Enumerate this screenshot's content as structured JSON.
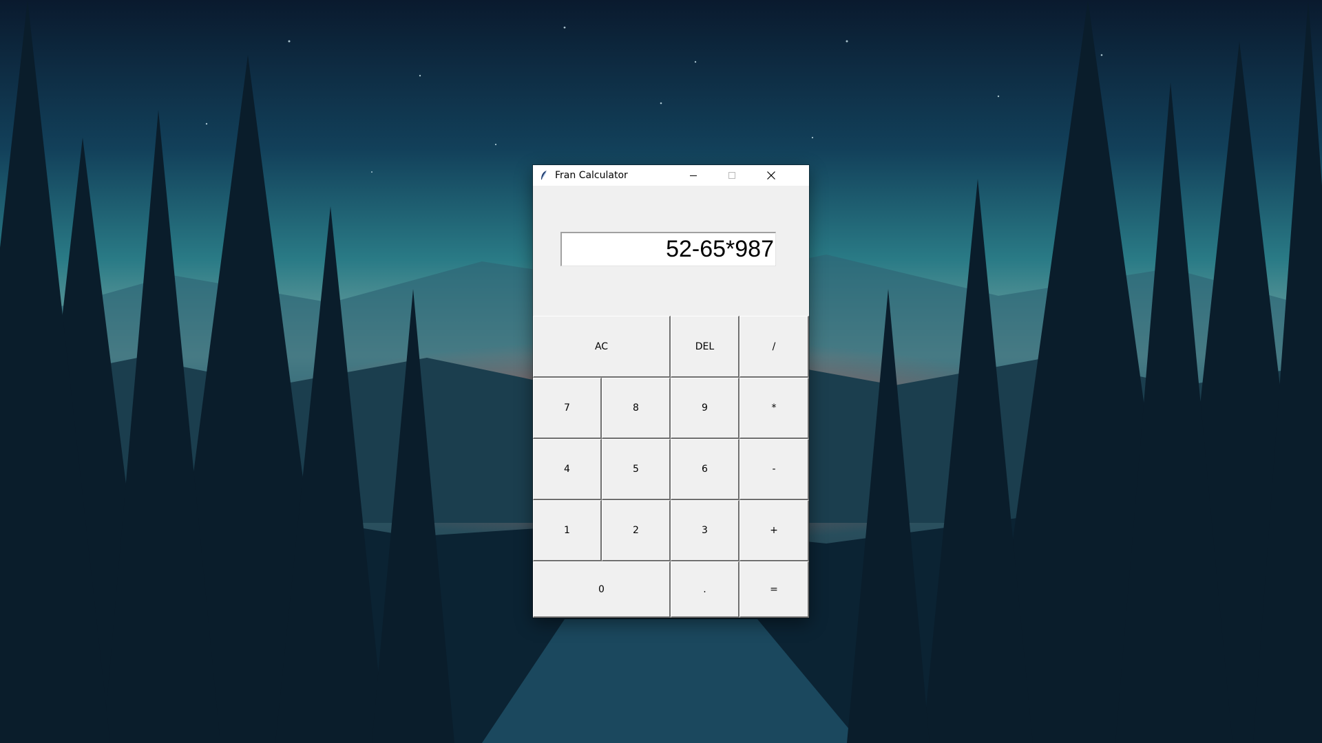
{
  "window": {
    "title": "Fran Calculator",
    "app_icon": "feather-icon",
    "controls": [
      "minimize",
      "maximize",
      "close"
    ]
  },
  "display": {
    "value": "52-65*987"
  },
  "keypad": {
    "rows": [
      [
        "AC",
        "DEL",
        "/"
      ],
      [
        "7",
        "8",
        "9",
        "*"
      ],
      [
        "4",
        "5",
        "6",
        "-"
      ],
      [
        "1",
        "2",
        "3",
        "+"
      ],
      [
        "0",
        ".",
        "="
      ]
    ]
  },
  "colors": {
    "window_bg": "#f0f0f0",
    "titlebar_bg": "#ffffff",
    "display_bg": "#ffffff"
  }
}
